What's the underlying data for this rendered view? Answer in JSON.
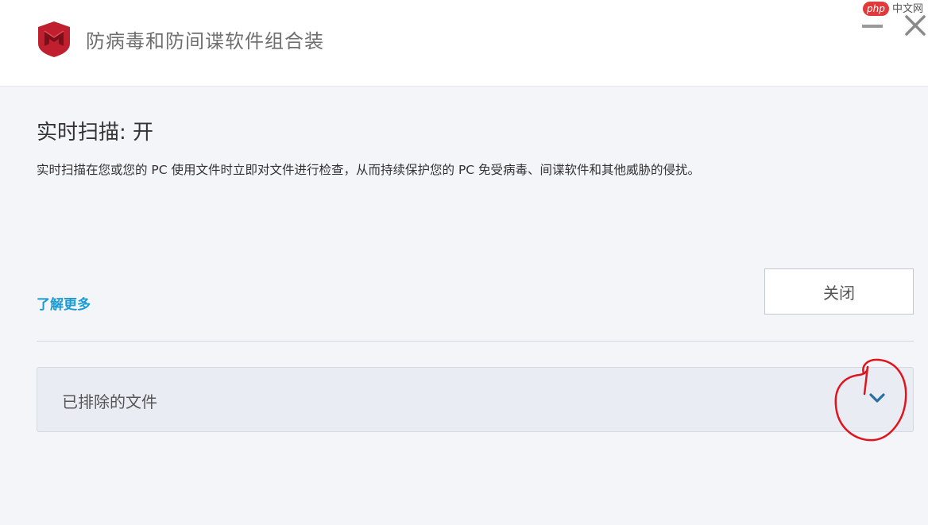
{
  "window": {
    "title": "防病毒和防间谍软件组合装",
    "minimize_icon": "minimize-icon",
    "close_icon": "close-icon"
  },
  "watermark": {
    "badge": "php",
    "text": "中文网"
  },
  "realtime_scan": {
    "title": "实时扫描: 开",
    "description": "实时扫描在您或您的 PC 使用文件时立即对文件进行检查，从而持续保护您的 PC 免受病毒、间谍软件和其他威胁的侵扰。",
    "learn_more_label": "了解更多",
    "close_button_label": "关闭"
  },
  "excluded_files": {
    "label": "已排除的文件",
    "expand_icon": "chevron-down-icon"
  },
  "colors": {
    "brand_red": "#c01f2f",
    "link_blue": "#1c9bd3",
    "chevron_blue": "#2a6ea8",
    "annotation_red": "#e0141e"
  }
}
